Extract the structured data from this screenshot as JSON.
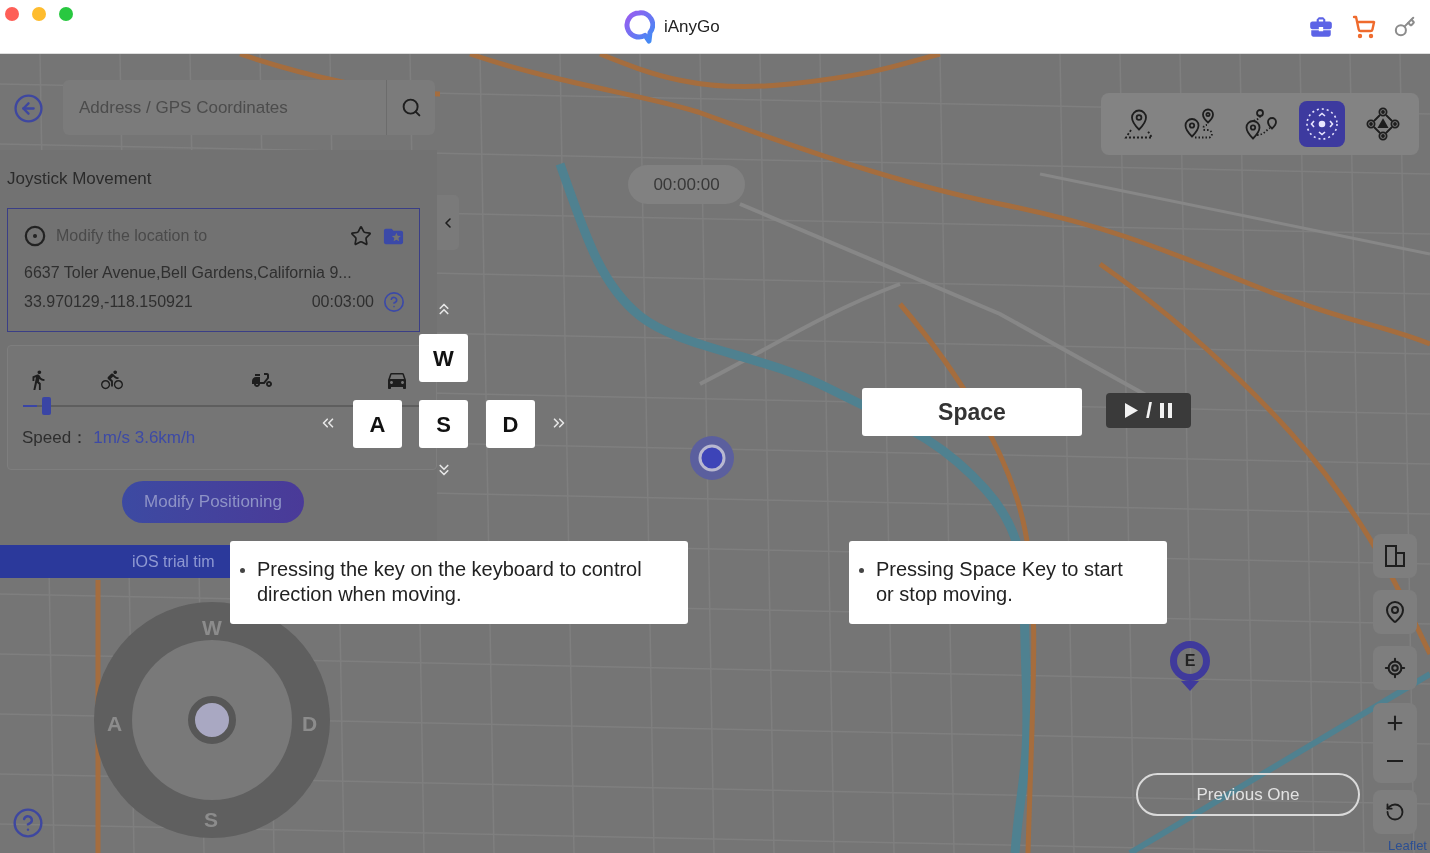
{
  "title_bar": {
    "app_name": "iAnyGo"
  },
  "search": {
    "placeholder": "Address / GPS Coordinates"
  },
  "timer": "00:00:00",
  "mode_toolbar": [
    {
      "kind": "teleport",
      "selected": false
    },
    {
      "kind": "two_spot",
      "selected": false
    },
    {
      "kind": "multi_spot",
      "selected": false
    },
    {
      "kind": "joystick",
      "selected": true
    },
    {
      "kind": "dpad",
      "selected": false
    }
  ],
  "panel": {
    "title": "Joystick Movement",
    "location": {
      "label": "Modify the location to",
      "address": "6637 Toler Avenue,Bell Gardens,California 9...",
      "coordinates": "33.970129,-118.150921",
      "duration": "00:03:00"
    },
    "speed": {
      "level": 0.035,
      "label": "Speed：",
      "value": "1m/s 3.6km/h"
    },
    "button": "Modify Positioning",
    "trial_banner": "iOS trial tim"
  },
  "keys": {
    "up": "W",
    "left": "A",
    "down": "S",
    "right": "D",
    "space": "Space"
  },
  "play_pause": {
    "separator": "/"
  },
  "tips": [
    {
      "text": "Pressing the key on the keyboard to control direction when moving."
    },
    {
      "text": "Pressing Space Key to start or stop moving."
    }
  ],
  "joystick": {
    "up": "W",
    "left": "A",
    "right": "D",
    "down": "S"
  },
  "end_marker": {
    "label": "E"
  },
  "previous_button": "Previous One",
  "attribution": "Leaflet"
}
